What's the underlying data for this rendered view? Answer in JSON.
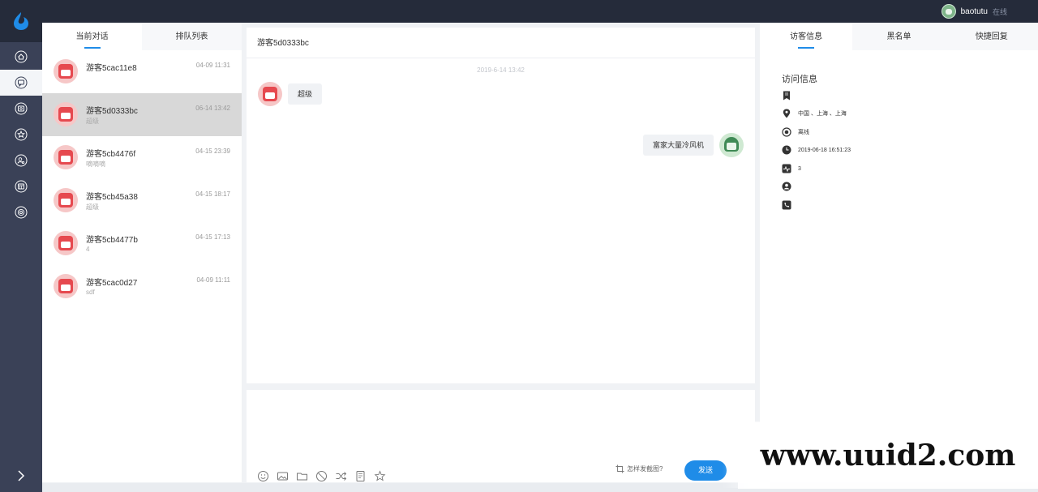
{
  "topbar": {
    "username": "baotutu",
    "status": "在线"
  },
  "sidebar": {
    "logo_icon": "logo-icon",
    "items": [
      {
        "name": "home",
        "icon": "home-icon",
        "active": false
      },
      {
        "name": "conversations",
        "icon": "chat-icon",
        "active": true
      },
      {
        "name": "history",
        "icon": "history-icon",
        "active": false
      },
      {
        "name": "favorites",
        "icon": "star-icon",
        "active": false
      },
      {
        "name": "visitors",
        "icon": "user-icon",
        "active": false
      },
      {
        "name": "statistics",
        "icon": "calculator-icon",
        "active": false
      },
      {
        "name": "settings",
        "icon": "settings-icon",
        "active": false
      }
    ],
    "collapse_icon": "chevron-right-icon"
  },
  "convlist": {
    "tabs": [
      "当前对话",
      "排队列表"
    ],
    "conversations": [
      {
        "name": "游客5cac11e8",
        "time": "04-09 11:31",
        "message": ""
      },
      {
        "name": "游客5d0333bc",
        "time": "06-14 13:42",
        "message": "超级"
      },
      {
        "name": "游客5cb4476f",
        "time": "04-15 23:39",
        "message": "嘀嘀嘀"
      },
      {
        "name": "游客5cb45a38",
        "time": "04-15 18:17",
        "message": "超级"
      },
      {
        "name": "游客5cb4477b",
        "time": "04-15 17:13",
        "message": "4"
      },
      {
        "name": "游客5cac0d27",
        "time": "04-09 11:11",
        "message": "sdf"
      }
    ]
  },
  "chat": {
    "title": "游客5d0333bc",
    "timestamp": "2019-6-14 13:42",
    "messages": [
      {
        "side": "left",
        "text": "超级"
      },
      {
        "side": "right",
        "text": "富家大量冷风机"
      }
    ]
  },
  "input": {
    "tools": [
      "emoji-icon",
      "image-icon",
      "folder-icon",
      "block-icon",
      "transfer-icon",
      "document-icon",
      "star-icon"
    ],
    "screenshot_hint": "怎样发截图?",
    "send_label": "发送"
  },
  "info": {
    "tabs": [
      "访客信息",
      "黑名单",
      "快捷回复"
    ],
    "title": "访问信息",
    "rows": [
      {
        "icon": "bookmark-icon",
        "text": ""
      },
      {
        "icon": "location-icon",
        "text": "中国 、上海 、上海"
      },
      {
        "icon": "status-icon",
        "text": "离线"
      },
      {
        "icon": "clock-icon",
        "text": "2019-06-18 16:51:23"
      },
      {
        "icon": "activity-icon",
        "text": "3"
      },
      {
        "icon": "person-icon",
        "text": ""
      },
      {
        "icon": "phone-icon",
        "text": ""
      }
    ]
  },
  "watermark": "www.uuid2.com",
  "colors": {
    "accent": "#1f8ce8",
    "sidebar": "#3a4157",
    "topbar": "#252b3a"
  }
}
